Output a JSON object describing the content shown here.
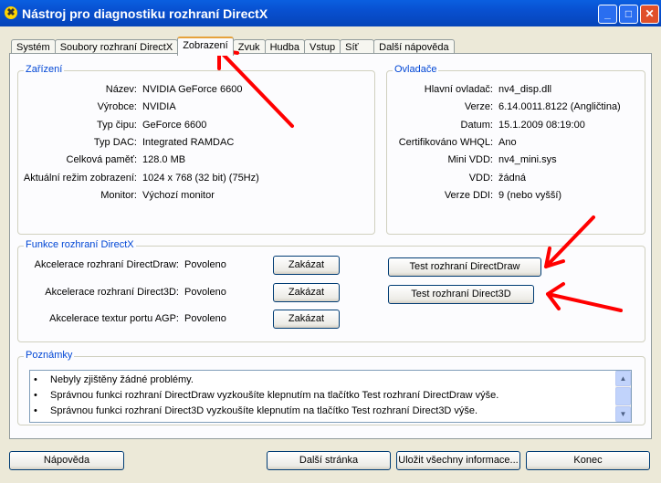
{
  "window": {
    "title": "Nástroj pro diagnostiku rozhraní DirectX"
  },
  "tabs": [
    "Systém",
    "Soubory rozhraní DirectX",
    "Zobrazení",
    "Zvuk",
    "Hudba",
    "Vstup",
    "Síť",
    "Další nápověda"
  ],
  "device": {
    "title": "Zařízení",
    "rows": [
      {
        "label": "Název:",
        "value": "NVIDIA GeForce 6600"
      },
      {
        "label": "Výrobce:",
        "value": "NVIDIA"
      },
      {
        "label": "Typ čipu:",
        "value": "GeForce 6600"
      },
      {
        "label": "Typ DAC:",
        "value": "Integrated RAMDAC"
      },
      {
        "label": "Celková paměť:",
        "value": "128.0 MB"
      },
      {
        "label": "Aktuální režim zobrazení:",
        "value": "1024 x 768 (32 bit) (75Hz)"
      },
      {
        "label": "Monitor:",
        "value": "Výchozí monitor"
      }
    ]
  },
  "drivers": {
    "title": "Ovladače",
    "rows": [
      {
        "label": "Hlavní ovladač:",
        "value": "nv4_disp.dll"
      },
      {
        "label": "Verze:",
        "value": "6.14.0011.8122 (Angličtina)"
      },
      {
        "label": "Datum:",
        "value": "15.1.2009 08:19:00"
      },
      {
        "label": "Certifikováno WHQL:",
        "value": "Ano"
      },
      {
        "label": "Mini VDD:",
        "value": "nv4_mini.sys"
      },
      {
        "label": "VDD:",
        "value": "žádná"
      },
      {
        "label": "Verze DDI:",
        "value": "9 (nebo vyšší)"
      }
    ]
  },
  "features": {
    "title": "Funkce rozhraní DirectX",
    "rows": [
      {
        "label": "Akcelerace rozhraní DirectDraw:",
        "value": "Povoleno",
        "button": "Zakázat"
      },
      {
        "label": "Akcelerace rozhraní Direct3D:",
        "value": "Povoleno",
        "button": "Zakázat"
      },
      {
        "label": "Akcelerace textur portu AGP:",
        "value": "Povoleno",
        "button": "Zakázat"
      }
    ],
    "test_directdraw": "Test rozhraní DirectDraw",
    "test_direct3d": "Test rozhraní Direct3D"
  },
  "notes": {
    "title": "Poznámky",
    "items": [
      "Nebyly zjištěny žádné problémy.",
      "Správnou funkci rozhraní DirectDraw vyzkoušíte klepnutím na tlačítko Test rozhraní DirectDraw výše.",
      "Správnou funkci rozhraní Direct3D vyzkoušíte klepnutím na tlačítko Test rozhraní Direct3D výše."
    ]
  },
  "footer": {
    "help": "Nápověda",
    "next": "Další stránka",
    "save": "Uložit všechny informace...",
    "exit": "Konec"
  },
  "colors": {
    "arrow": "#ff0000",
    "accent": "#0046d5"
  }
}
